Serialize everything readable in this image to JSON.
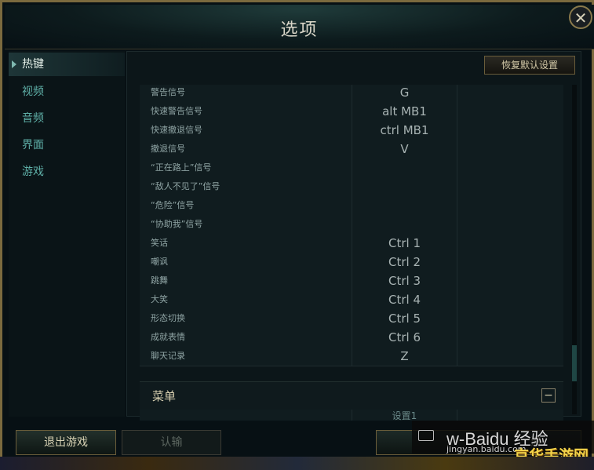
{
  "window": {
    "title": "选项",
    "close_symbol": "✕"
  },
  "sidebar": {
    "items": [
      {
        "label": "热键",
        "active": true
      },
      {
        "label": "视频",
        "active": false
      },
      {
        "label": "音频",
        "active": false
      },
      {
        "label": "界面",
        "active": false
      },
      {
        "label": "游戏",
        "active": false
      }
    ]
  },
  "main": {
    "restore_label": "恢复默认设置",
    "keybinds": [
      {
        "name": "警告信号",
        "key": "G"
      },
      {
        "name": "快速警告信号",
        "key": "alt  MB1"
      },
      {
        "name": "快速撤退信号",
        "key": "ctrl  MB1"
      },
      {
        "name": "撤退信号",
        "key": "V"
      },
      {
        "name": "“正在路上”信号",
        "key": ""
      },
      {
        "name": "“敌人不见了”信号",
        "key": ""
      },
      {
        "name": "“危险”信号",
        "key": ""
      },
      {
        "name": "“协助我”信号",
        "key": ""
      },
      {
        "name": "笑话",
        "key": "Ctrl  1"
      },
      {
        "name": "嘲讽",
        "key": "Ctrl  2"
      },
      {
        "name": "跳舞",
        "key": "Ctrl  3"
      },
      {
        "name": "大笑",
        "key": "Ctrl  4"
      },
      {
        "name": "形态切换",
        "key": "Ctrl  5"
      },
      {
        "name": "成就表情",
        "key": "Ctrl  6"
      },
      {
        "name": "聊天记录",
        "key": "Z"
      }
    ],
    "section_title": "菜单",
    "collapse_symbol": "−",
    "sub_label": "设置1"
  },
  "footer": {
    "exit_label": "退出游戏",
    "surrender_label": "认输",
    "right_label": "清"
  },
  "watermark": {
    "text": "w-Baidu 经验",
    "url": "jingyan.baidu.com",
    "brand": "京华手游网"
  },
  "colors": {
    "accent": "#5fb0a8",
    "gold": "#7b6a3e"
  }
}
